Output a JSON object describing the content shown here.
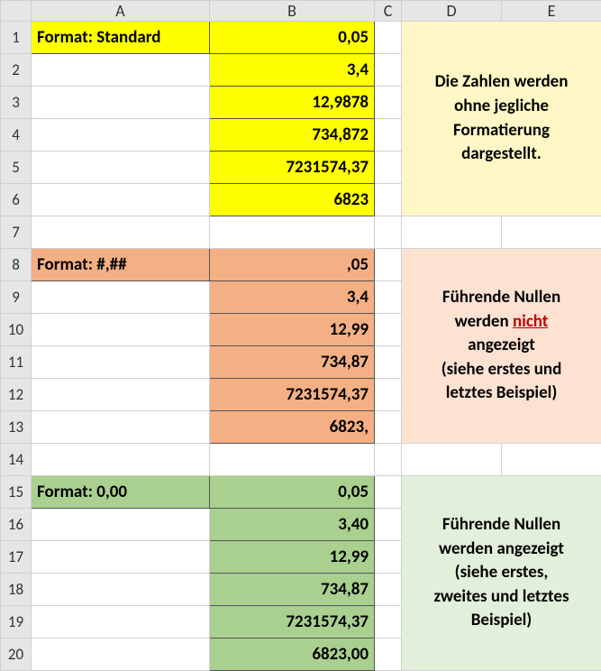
{
  "headers": {
    "rowcorner": "",
    "A": "A",
    "B": "B",
    "C": "C",
    "D": "D",
    "E": "E"
  },
  "rownums": {
    "r1": "1",
    "r2": "2",
    "r3": "3",
    "r4": "4",
    "r5": "5",
    "r6": "6",
    "r7": "7",
    "r8": "8",
    "r9": "9",
    "r10": "10",
    "r11": "11",
    "r12": "12",
    "r13": "13",
    "r14": "14",
    "r15": "15",
    "r16": "16",
    "r17": "17",
    "r18": "18",
    "r19": "19",
    "r20": "20"
  },
  "section1": {
    "label": "Format: Standard",
    "values": {
      "v1": "0,05",
      "v2": "3,4",
      "v3": "12,9878",
      "v4": "734,872",
      "v5": "7231574,37",
      "v6": "6823"
    },
    "note_l1": "Die Zahlen werden",
    "note_l2": "ohne jegliche",
    "note_l3": "Formatierung",
    "note_l4": "dargestellt."
  },
  "section2": {
    "label": "Format: #,##",
    "values": {
      "v1": ",05",
      "v2": "3,4",
      "v3": "12,99",
      "v4": "734,87",
      "v5": "7231574,37",
      "v6": "6823,"
    },
    "note_l1": "Führende Nullen",
    "note_l2a": "werden ",
    "note_l2b": "nicht",
    "note_l3": "angezeigt",
    "note_l4": "(siehe erstes und",
    "note_l5": "letztes Beispiel)"
  },
  "section3": {
    "label": "Format: 0,00",
    "values": {
      "v1": "0,05",
      "v2": "3,40",
      "v3": "12,99",
      "v4": "734,87",
      "v5": "7231574,37",
      "v6": "6823,00"
    },
    "note_l1": "Führende Nullen",
    "note_l2": "werden angezeigt",
    "note_l3": "(siehe erstes,",
    "note_l4": "zweites und letztes",
    "note_l5": "Beispiel)"
  }
}
